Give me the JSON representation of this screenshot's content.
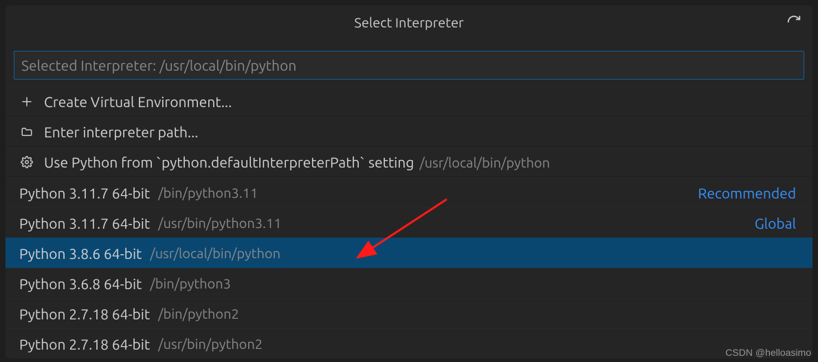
{
  "dialog": {
    "title": "Select Interpreter",
    "search_placeholder": "Selected Interpreter: /usr/local/bin/python"
  },
  "actions": [
    {
      "id": "create-venv",
      "icon": "plus",
      "label": "Create Virtual Environment..."
    },
    {
      "id": "enter-path",
      "icon": "folder",
      "label": "Enter interpreter path..."
    },
    {
      "id": "use-default",
      "icon": "gear",
      "label": "Use Python from `python.defaultInterpreterPath` setting",
      "path": "/usr/local/bin/python"
    }
  ],
  "interpreters": [
    {
      "label": "Python 3.11.7 64-bit",
      "path": "/bin/python3.11",
      "badge": "Recommended",
      "selected": false
    },
    {
      "label": "Python 3.11.7 64-bit",
      "path": "/usr/bin/python3.11",
      "badge": "Global",
      "selected": false
    },
    {
      "label": "Python 3.8.6 64-bit",
      "path": "/usr/local/bin/python",
      "badge": "",
      "selected": true
    },
    {
      "label": "Python 3.6.8 64-bit",
      "path": "/bin/python3",
      "badge": "",
      "selected": false
    },
    {
      "label": "Python 2.7.18 64-bit",
      "path": "/bin/python2",
      "badge": "",
      "selected": false
    },
    {
      "label": "Python 2.7.18 64-bit",
      "path": "/usr/bin/python2",
      "badge": "",
      "selected": false
    }
  ],
  "watermark": "CSDN @helloasimo"
}
